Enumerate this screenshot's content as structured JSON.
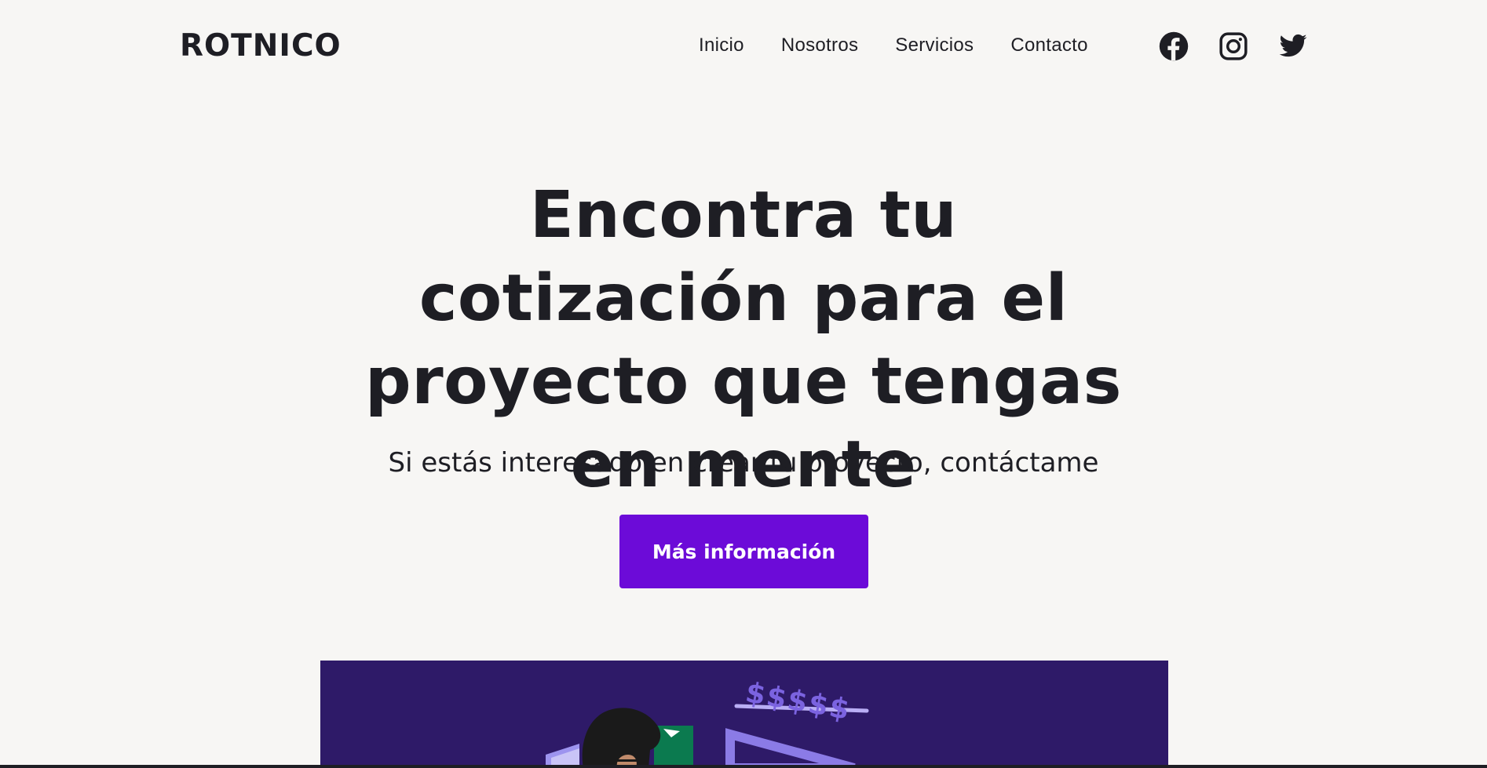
{
  "header": {
    "logo": "ROTNICO",
    "nav": [
      "Inicio",
      "Nosotros",
      "Servicios",
      "Contacto"
    ],
    "social": [
      "facebook-icon",
      "instagram-icon",
      "twitter-icon"
    ]
  },
  "hero": {
    "title": "Encontra tu cotización para el proyecto que tengas en mente",
    "subtitle": "Si estás interesado en crear tu proyecto, contáctame",
    "cta_label": "Más información"
  },
  "illustration": {
    "dollar_signs": "$$$$$",
    "colors": {
      "background": "#2e1a68",
      "accent": "#6c0bd8",
      "lavender": "#8b7be6"
    }
  }
}
